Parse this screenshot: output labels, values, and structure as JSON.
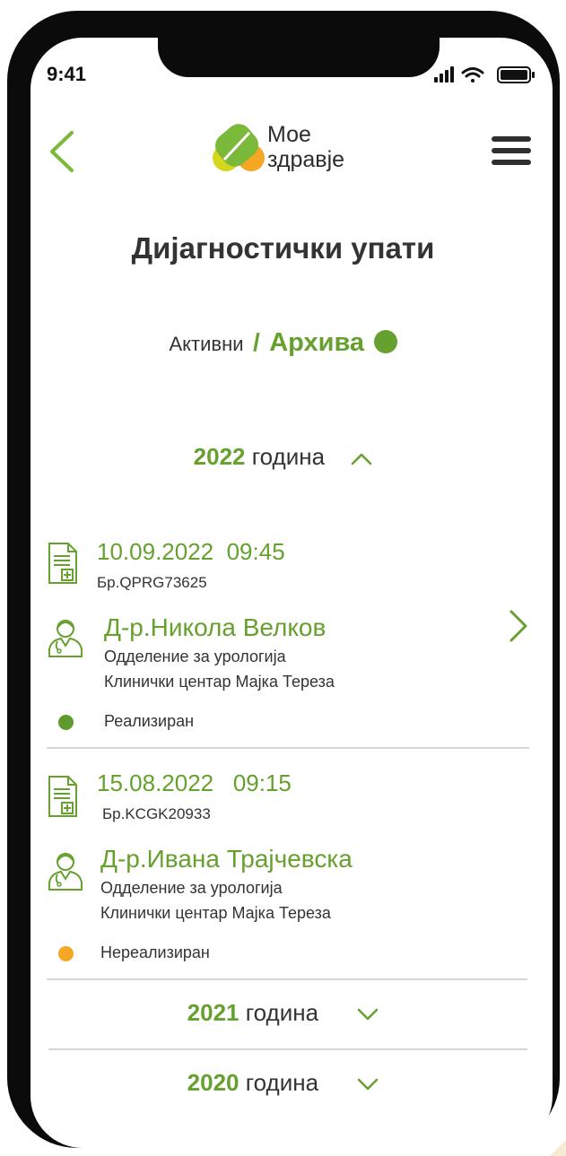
{
  "status_bar": {
    "time": "9:41"
  },
  "header": {
    "logo_line1": "Мое",
    "logo_line2": "здравје"
  },
  "page_title": "Дијагностички упати",
  "toggle": {
    "inactive_label": "Активни",
    "separator": "/",
    "active_label": "Архива"
  },
  "years": [
    {
      "year": "2022",
      "label": "година",
      "expanded": true
    },
    {
      "year": "2021",
      "label": "година",
      "expanded": false
    },
    {
      "year": "2020",
      "label": "година",
      "expanded": false
    }
  ],
  "referrals": [
    {
      "date": "10.09.2022",
      "time": "09:45",
      "number": "Бр.QPRG73625",
      "doctor": "Д-р.Никола Велков",
      "department": "Одделение за урологија",
      "clinic": "Клинички центар Мајка Тереза",
      "status": "Реализиран",
      "status_color": "#5e9a2c"
    },
    {
      "date": "15.08.2022",
      "time": "09:15",
      "number": "Бр.KCGK20933",
      "doctor": "Д-р.Ивана Трајчевска",
      "department": "Одделение за урологија",
      "clinic": "Клинички центар Мајка Тереза",
      "status": "Нереализиран",
      "status_color": "#f5a623"
    }
  ],
  "colors": {
    "accent": "#66a02e",
    "text": "#333333",
    "divider": "#d6d6d6"
  }
}
